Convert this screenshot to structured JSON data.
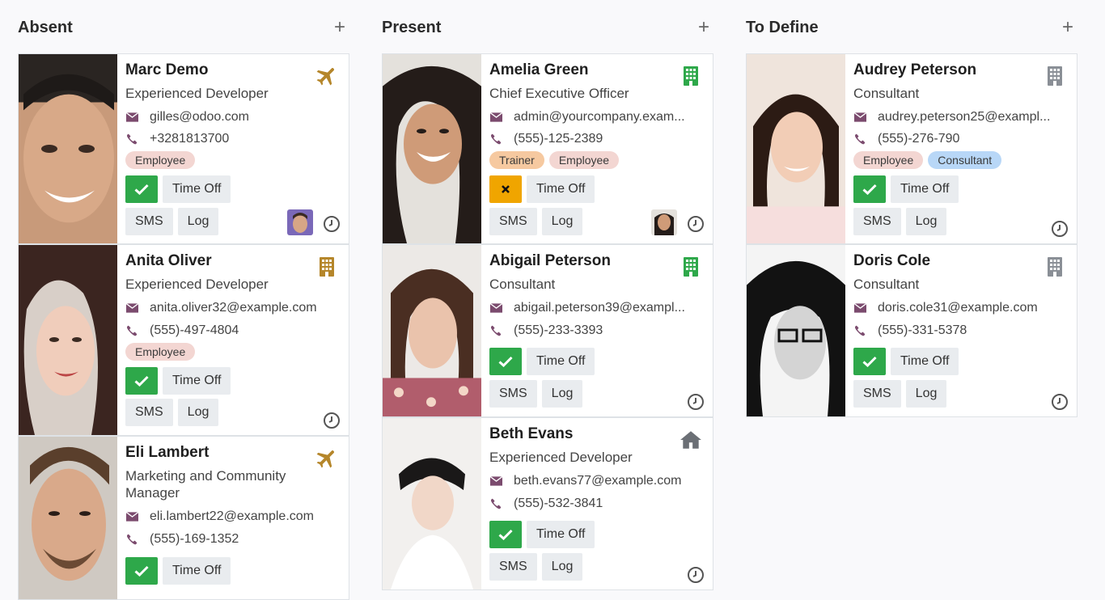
{
  "columns": [
    {
      "title": "Absent",
      "add_symbol": "+",
      "cards": [
        {
          "name": "Marc Demo",
          "job": "Experienced Developer",
          "email": "gilles@odoo.com",
          "phone": "+3281813700",
          "tags": [
            "Employee"
          ],
          "status_icon": "plane-icon",
          "presence_button": "check",
          "buttons": [
            "Time Off",
            "SMS",
            "Log"
          ]
        },
        {
          "name": "Anita Oliver",
          "job": "Experienced Developer",
          "email": "anita.oliver32@example.com",
          "phone": "(555)-497-4804",
          "tags": [
            "Employee"
          ],
          "status_icon": "building-icon",
          "presence_button": "check",
          "buttons": [
            "Time Off",
            "SMS",
            "Log"
          ]
        },
        {
          "name": "Eli Lambert",
          "job": "Marketing and Community Manager",
          "email": "eli.lambert22@example.com",
          "phone": "(555)-169-1352",
          "tags": [],
          "status_icon": "plane-icon",
          "presence_button": "check",
          "buttons": [
            "Time Off"
          ]
        }
      ]
    },
    {
      "title": "Present",
      "add_symbol": "+",
      "cards": [
        {
          "name": "Amelia Green",
          "job": "Chief Executive Officer",
          "email": "admin@yourcompany.exam...",
          "phone": "(555)-125-2389",
          "tags": [
            "Trainer",
            "Employee"
          ],
          "status_icon": "building-icon",
          "presence_button": "cross",
          "buttons": [
            "Time Off",
            "SMS",
            "Log"
          ]
        },
        {
          "name": "Abigail Peterson",
          "job": "Consultant",
          "email": "abigail.peterson39@exampl...",
          "phone": "(555)-233-3393",
          "tags": [],
          "status_icon": "building-icon",
          "presence_button": "check",
          "buttons": [
            "Time Off",
            "SMS",
            "Log"
          ]
        },
        {
          "name": "Beth Evans",
          "job": "Experienced Developer",
          "email": "beth.evans77@example.com",
          "phone": "(555)-532-3841",
          "tags": [],
          "status_icon": "home-icon",
          "presence_button": "check",
          "buttons": [
            "Time Off",
            "SMS",
            "Log"
          ]
        }
      ]
    },
    {
      "title": "To Define",
      "add_symbol": "+",
      "cards": [
        {
          "name": "Audrey Peterson",
          "job": "Consultant",
          "email": "audrey.peterson25@exampl...",
          "phone": "(555)-276-790",
          "tags": [
            "Employee",
            "Consultant"
          ],
          "status_icon": "building-icon",
          "presence_button": "check",
          "buttons": [
            "Time Off",
            "SMS",
            "Log"
          ]
        },
        {
          "name": "Doris Cole",
          "job": "Consultant",
          "email": "doris.cole31@example.com",
          "phone": "(555)-331-5378",
          "tags": [],
          "status_icon": "building-icon",
          "presence_button": "check",
          "buttons": [
            "Time Off",
            "SMS",
            "Log"
          ]
        }
      ]
    }
  ],
  "colors": {
    "status_absent": "#b5862a",
    "status_present": "#2ea84a",
    "status_undefined": "#8a8f96",
    "status_home": "#6b6f75",
    "check_button": "#2ea84a",
    "cross_button": "#f0a500",
    "icon_purple": "#7b4b6e"
  }
}
